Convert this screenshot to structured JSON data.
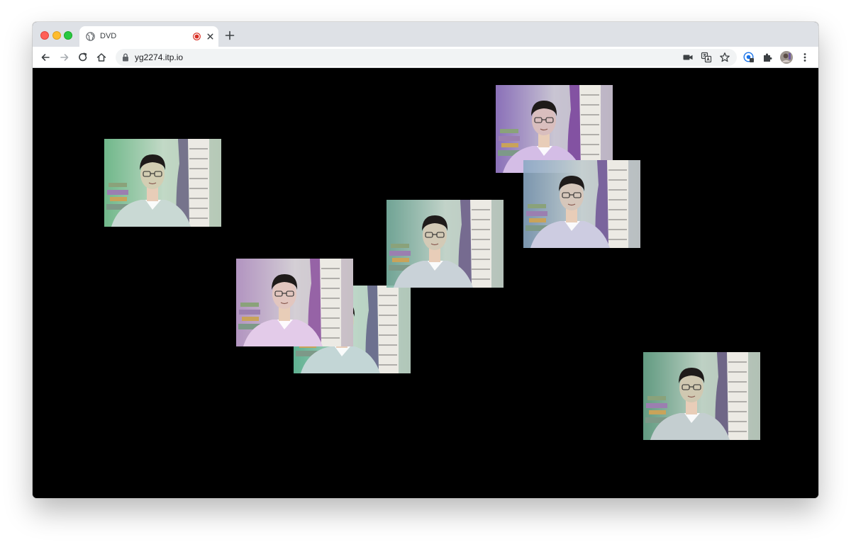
{
  "browser": {
    "tab": {
      "title": "DVD",
      "favicon": "globe-icon",
      "recording_indicator": "recording-icon"
    },
    "address_bar": {
      "url": "yg2274.itp.io",
      "secure": true
    },
    "toolbar_icons": [
      "camera-icon",
      "translate-icon",
      "star-icon",
      "extension-account-icon",
      "puzzle-icon",
      "profile-avatar",
      "menu-icon"
    ]
  },
  "page": {
    "background": "#000000",
    "frames": [
      {
        "tint": "#7fcf9d"
      },
      {
        "tint": "#6cc7a4"
      },
      {
        "tint": "#c9a7d9"
      },
      {
        "tint": "#7fb9a8"
      },
      {
        "tint": "#9d7fd0"
      },
      {
        "tint": "#8aa9c4"
      },
      {
        "tint": "#6fae92"
      }
    ]
  },
  "colors": {
    "tab_strip": "#dee1e6",
    "accent_recording": "#d93025"
  }
}
